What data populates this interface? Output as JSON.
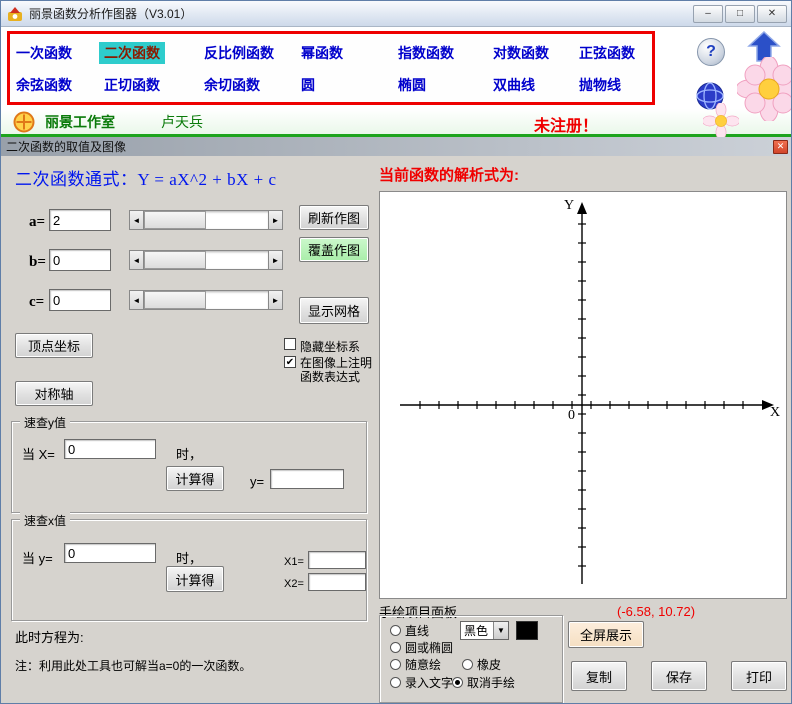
{
  "titlebar": {
    "title": "丽景函数分析作图器（V3.01）",
    "minimize": "–",
    "maximize": "□",
    "close": "✕"
  },
  "nav": {
    "row1": [
      "一次函数",
      "二次函数",
      "反比例函数",
      "幂函数",
      "指数函数",
      "对数函数",
      "正弦函数"
    ],
    "row2": [
      "余弦函数",
      "正切函数",
      "余切函数",
      "圆",
      "椭圆",
      "双曲线",
      "抛物线"
    ],
    "selected": "二次函数"
  },
  "icons": {
    "help": "?"
  },
  "studio": {
    "name": "丽景工作室",
    "author": "卢天兵",
    "register_status": "未注册！"
  },
  "panel": {
    "title": "二次函数的取值及图像",
    "close": "✕"
  },
  "form": {
    "formula": "二次函数通式：Y = aX^2 + bX + c",
    "a_label": "a=",
    "a_value": "2",
    "b_label": "b=",
    "b_value": "0",
    "c_label": "c=",
    "c_value": "0",
    "scroll_left": "◄",
    "scroll_right": "►",
    "refresh_button": "刷新作图",
    "overlay_button": "覆盖作图",
    "grid_button": "显示网格",
    "hide_axes_label": "隐藏坐标系",
    "annotate_line1": "在图像上注明",
    "annotate_line2": "函数表达式",
    "check_glyph": "✔",
    "vertex_button": "顶点坐标",
    "symmetry_button": "对称轴"
  },
  "quick_y": {
    "title": "速查y值",
    "prefix": "当 X=",
    "value": "0",
    "suffix": "时，",
    "calc_button": "计算得",
    "result_label": "y="
  },
  "quick_x": {
    "title": "速查x值",
    "prefix": "当 y=",
    "value": "0",
    "suffix": "时，",
    "calc_button": "计算得",
    "x1_label": "X1=",
    "x2_label": "X2="
  },
  "notes": {
    "equation": "此时方程为:",
    "hint": "注：利用此处工具也可解当a=0的一次函数。"
  },
  "plot": {
    "header": "当前函数的解析式为:",
    "y_axis": "Y",
    "x_axis": "X",
    "origin": "0",
    "cursor_coords": "(-6.58, 10.72)"
  },
  "draw_panel": {
    "title": "手绘项目面板",
    "line": "直线",
    "circle": "圆或椭圆",
    "freehand": "随意绘",
    "text": "录入文字",
    "color_value": "黑色",
    "dropdown_glyph": "▼",
    "eraser": "橡皮",
    "cancel": "取消手绘",
    "selected": "取消手绘"
  },
  "actions": {
    "fullscreen": "全屏展示",
    "copy": "复制",
    "save": "保存",
    "print": "打印"
  },
  "colors": {
    "accent_red": "#ee0000",
    "selected_teal": "#2ecccc",
    "nav_blue": "#0000cc",
    "formula_blue": "#0016ee",
    "alert_red": "#f00000",
    "overlay_green": "#a9eda9"
  }
}
